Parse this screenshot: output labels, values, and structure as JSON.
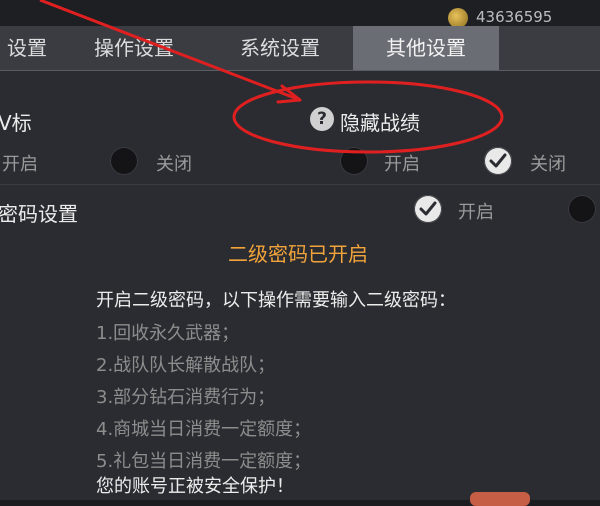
{
  "header": {
    "currency_value": "43636595"
  },
  "tabs": [
    {
      "label": "设置"
    },
    {
      "label": "操作设置"
    },
    {
      "label": "系统设置"
    },
    {
      "label": "其他设置"
    }
  ],
  "settings": {
    "v_mark": {
      "label": "V标",
      "on_label": "开启",
      "off_label": "关闭"
    },
    "hide_stats": {
      "label": "隐藏战绩",
      "on_label": "开启",
      "off_label": "关闭"
    },
    "password": {
      "label": "密码设置",
      "on_label": "开启"
    }
  },
  "password_info": {
    "status": "二级密码已开启",
    "intro": "开启二级密码，以下操作需要输入二级密码：",
    "items": [
      "1.回收永久武器；",
      "2.战队队长解散战队；",
      "3.部分钻石消费行为；",
      "4.商城当日消费一定额度；",
      "5.礼包当日消费一定额度；"
    ],
    "footer": "您的账号正被安全保护！"
  },
  "colors": {
    "accent_orange": "#f2a33a",
    "annotation_red": "#e02020",
    "active_tab": "#6a6d73"
  }
}
